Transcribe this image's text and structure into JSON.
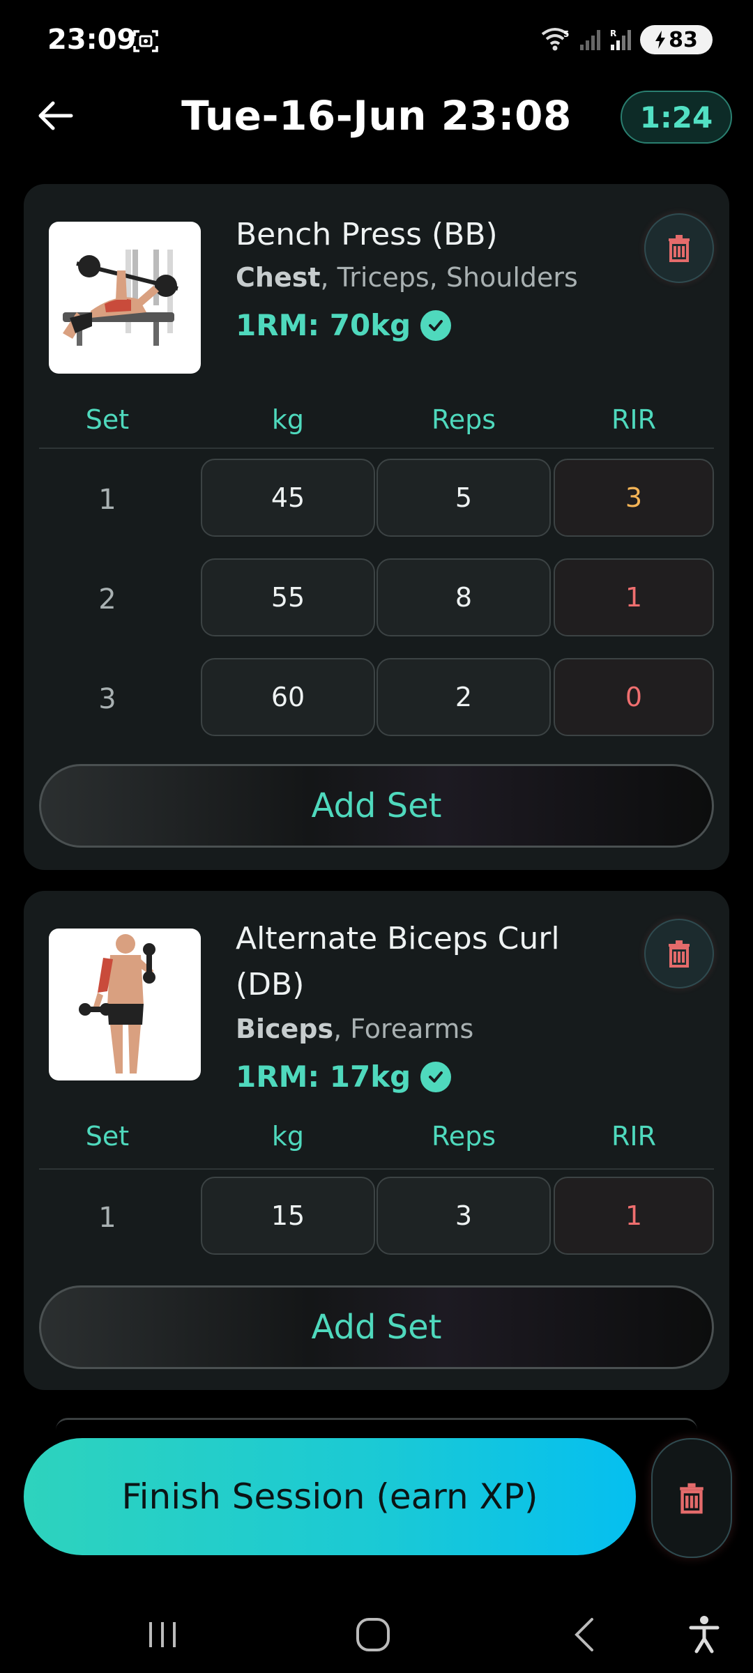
{
  "status_bar": {
    "time": "23:09",
    "battery": "83",
    "wifi_badge": "5",
    "signal_badge": "R"
  },
  "header": {
    "title": "Tue-16-Jun 23:08",
    "timer": "1:24"
  },
  "columns": {
    "set": "Set",
    "kg": "kg",
    "reps": "Reps",
    "rir": "RIR"
  },
  "exercises": [
    {
      "name": "Bench Press (BB)",
      "primary_muscle": "Chest",
      "secondary_muscles": ", Triceps, Shoulders",
      "one_rm": "1RM: 70kg",
      "sets": [
        {
          "set": "1",
          "kg": "45",
          "reps": "5",
          "rir": "3"
        },
        {
          "set": "2",
          "kg": "55",
          "reps": "8",
          "rir": "1"
        },
        {
          "set": "3",
          "kg": "60",
          "reps": "2",
          "rir": "0"
        }
      ],
      "add_set_label": "Add Set"
    },
    {
      "name": "Alternate Biceps Curl (DB)",
      "primary_muscle": "Biceps",
      "secondary_muscles": ", Forearms",
      "one_rm": "1RM: 17kg",
      "sets": [
        {
          "set": "1",
          "kg": "15",
          "reps": "3",
          "rir": "1"
        }
      ],
      "add_set_label": "Add Set"
    }
  ],
  "finish_label": "Finish Session (earn XP)",
  "colors": {
    "accent": "#4fd9bd",
    "rir_warn": "#f5b456",
    "rir_hard": "#ef6f6f",
    "delete": "#e46b6b"
  }
}
